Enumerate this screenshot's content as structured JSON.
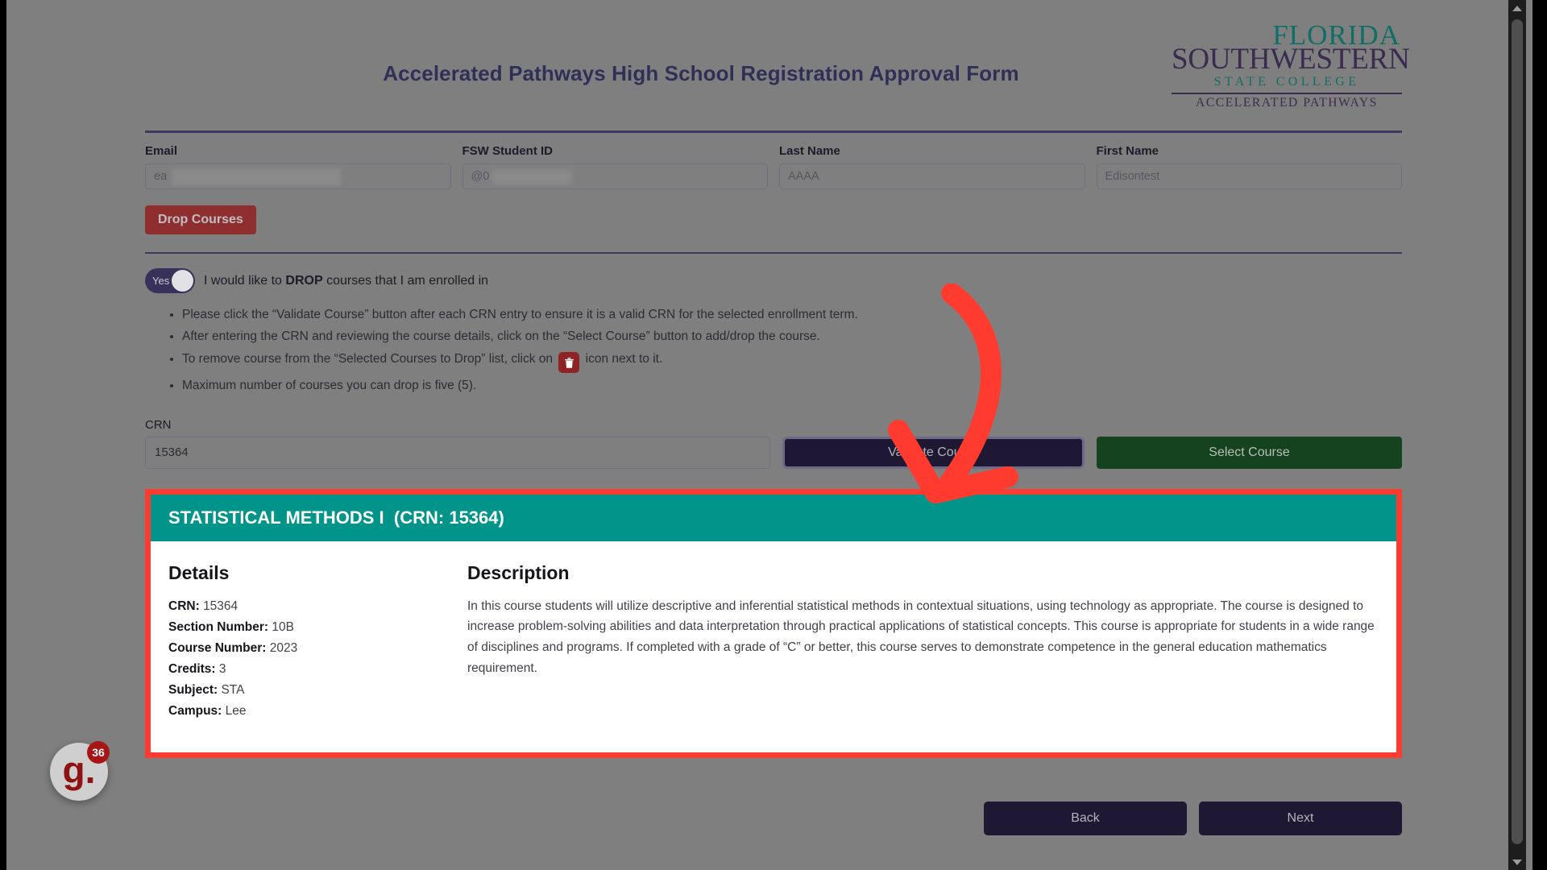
{
  "header": {
    "title": "Accelerated Pathways High School Registration Approval Form",
    "logo": {
      "line1": "FLORIDA",
      "line2": "SOUTHWESTERN",
      "line3": "STATE COLLEGE",
      "line4": "ACCELERATED PATHWAYS"
    }
  },
  "fields": [
    {
      "label": "Email",
      "value": "ea",
      "redacted": true
    },
    {
      "label": "FSW Student ID",
      "value": "@0",
      "redacted": true
    },
    {
      "label": "Last Name",
      "value": "AAAA",
      "redacted": false
    },
    {
      "label": "First Name",
      "value": "Edisontest",
      "redacted": false
    }
  ],
  "drop_courses_button": "Drop Courses",
  "toggle": {
    "state_label": "Yes",
    "text_before": "I would like to ",
    "text_bold": "DROP",
    "text_after": " courses that I am enrolled in"
  },
  "instructions": [
    "Please click the “Validate Course” button after each CRN entry to ensure it is a valid CRN for the selected enrollment term.",
    "After entering the CRN and reviewing the course details, click on the “Select Course” button to add/drop the course.",
    "Maximum number of courses you can drop is five (5)."
  ],
  "instruction_with_icon": {
    "before": "To remove course from the “Selected Courses to Drop” list, click on",
    "after": "icon next to it."
  },
  "crn": {
    "label": "CRN",
    "value": "15364",
    "validate_button": "Validate Course",
    "select_button": "Select Course"
  },
  "course_card": {
    "title": "STATISTICAL METHODS I",
    "crn_header": "(CRN: 15364)",
    "details_heading": "Details",
    "description_heading": "Description",
    "details": [
      {
        "label": "CRN:",
        "value": "15364"
      },
      {
        "label": "Section Number:",
        "value": "10B"
      },
      {
        "label": "Course Number:",
        "value": "2023"
      },
      {
        "label": "Credits:",
        "value": "3"
      },
      {
        "label": "Subject:",
        "value": "STA"
      },
      {
        "label": "Campus:",
        "value": "Lee"
      }
    ],
    "description": "In this course students will utilize descriptive and inferential statistical methods in contextual situations, using technology as appropriate. The course is designed to increase problem-solving abilities and data interpretation through practical applications of statistical concepts. This course is appropriate for students in a wide range of disciplines and programs. If completed with a grade of “C” or better, this course serves to demonstrate competence in the general education mathematics requirement."
  },
  "footer": {
    "back_button": "Back",
    "next_button": "Next"
  },
  "widget": {
    "glyph": "g.",
    "badge_count": "36"
  },
  "colors": {
    "page_overlay": "#807f7f",
    "title_navy": "#2f3057",
    "logo_teal": "#0f6e66",
    "logo_purple": "#3b2b50",
    "drop_red": "#8f2e2e",
    "validate_navy": "#1e1833",
    "select_green": "#15431f",
    "card_teal": "#00948a",
    "annotation_red": "#ff3b2f",
    "widget_red": "#a81515"
  }
}
